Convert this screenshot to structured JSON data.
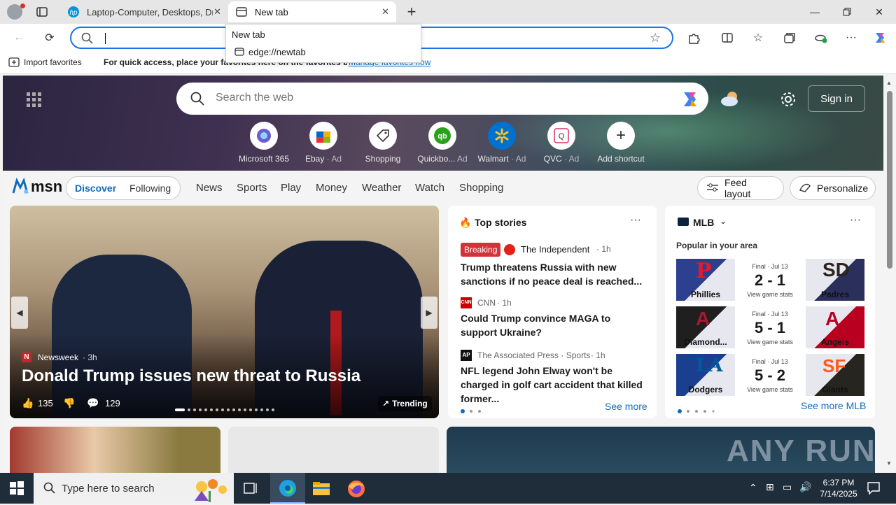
{
  "browser": {
    "tabs": [
      {
        "title": "Laptop-Computer, Desktops, Druc"
      },
      {
        "title": "New tab"
      }
    ],
    "address": {
      "value": ""
    },
    "dropdown": {
      "title": "New tab",
      "url": "edge://newtab"
    },
    "favorites_bar": {
      "import_label": "Import favorites",
      "message": "For quick access, place your favorites here on the favorites bar.",
      "link": "Manage favorites now"
    }
  },
  "newtab": {
    "search_placeholder": "Search the web",
    "signin": "Sign in",
    "shortcuts": [
      {
        "label": "Microsoft 365",
        "ad": ""
      },
      {
        "label": "Ebay",
        "ad": "· Ad"
      },
      {
        "label": "Shopping",
        "ad": ""
      },
      {
        "label": "Quickbo...",
        "ad": "Ad"
      },
      {
        "label": "Walmart",
        "ad": "· Ad"
      },
      {
        "label": "QVC",
        "ad": "· Ad"
      },
      {
        "label": "Add shortcut",
        "ad": ""
      }
    ],
    "brand": "msn",
    "nav": {
      "discover": "Discover",
      "following": "Following",
      "items": [
        "News",
        "Sports",
        "Play",
        "Money",
        "Weather",
        "Watch",
        "Shopping"
      ],
      "feed_layout": "Feed layout",
      "personalize": "Personalize"
    },
    "hero": {
      "source": "Newsweek",
      "time": "· 3h",
      "headline": "Donald Trump issues new threat to Russia",
      "likes": "135",
      "comments": "129",
      "trending": "Trending"
    },
    "top_stories": {
      "title": "Top stories",
      "items": [
        {
          "badge": "Breaking",
          "source": "The Independent",
          "time": "· 1h",
          "headline": "Trump threatens Russia with new sanctions if no peace deal is reached..."
        },
        {
          "badge": "",
          "source": "CNN",
          "time": "· 1h",
          "headline": "Could Trump convince MAGA to support Ukraine?"
        },
        {
          "badge": "",
          "source": "The Associated Press · Sports",
          "time": "· 1h",
          "headline": "NFL legend John Elway won't be charged in golf cart accident that killed former..."
        }
      ],
      "see_more": "See more"
    },
    "mlb": {
      "title": "MLB",
      "subtitle": "Popular in your area",
      "games": [
        {
          "status": "Final · Jul 13",
          "home": "Phillies",
          "away": "Padres",
          "score": "2 - 1",
          "stats": "View game stats"
        },
        {
          "status": "Final · Jul 13",
          "home": "Diamond...",
          "away": "Angels",
          "score": "5 - 1",
          "stats": "View game stats"
        },
        {
          "status": "Final · Jul 13",
          "home": "Dodgers",
          "away": "Giants",
          "score": "5 - 2",
          "stats": "View game stats"
        }
      ],
      "see_more": "See more MLB"
    },
    "watermark": "ANY RUN"
  },
  "taskbar": {
    "search_placeholder": "Type here to search",
    "time": "6:37 PM",
    "date": "7/14/2025"
  },
  "colors": {
    "accent": "#1a73e8",
    "msn_blue": "#0f6cbd",
    "breaking": "#d13438"
  }
}
